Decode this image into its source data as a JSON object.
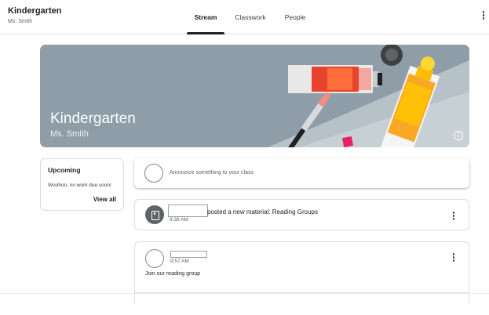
{
  "header": {
    "class_title": "Kindergarten",
    "teacher": "Ms. Smith",
    "tabs": [
      {
        "label": "Stream",
        "active": true
      },
      {
        "label": "Classwork",
        "active": false
      },
      {
        "label": "People",
        "active": false
      }
    ]
  },
  "banner": {
    "title": "Kindergarten",
    "subtitle": "Ms. Smith",
    "background_color": "#8e9da7",
    "info_icon": "i"
  },
  "upcoming": {
    "title": "Upcoming",
    "message": "Woohoo, no work due soon!",
    "link": "View all"
  },
  "announce": {
    "placeholder": "Announce something to your class"
  },
  "posts": [
    {
      "type": "material",
      "icon": "assignment-icon",
      "text": "posted a new material: Reading Groups",
      "time": "9:38 AM"
    },
    {
      "type": "announcement",
      "time": "9:57 AM",
      "body": "Join our reading group"
    }
  ]
}
